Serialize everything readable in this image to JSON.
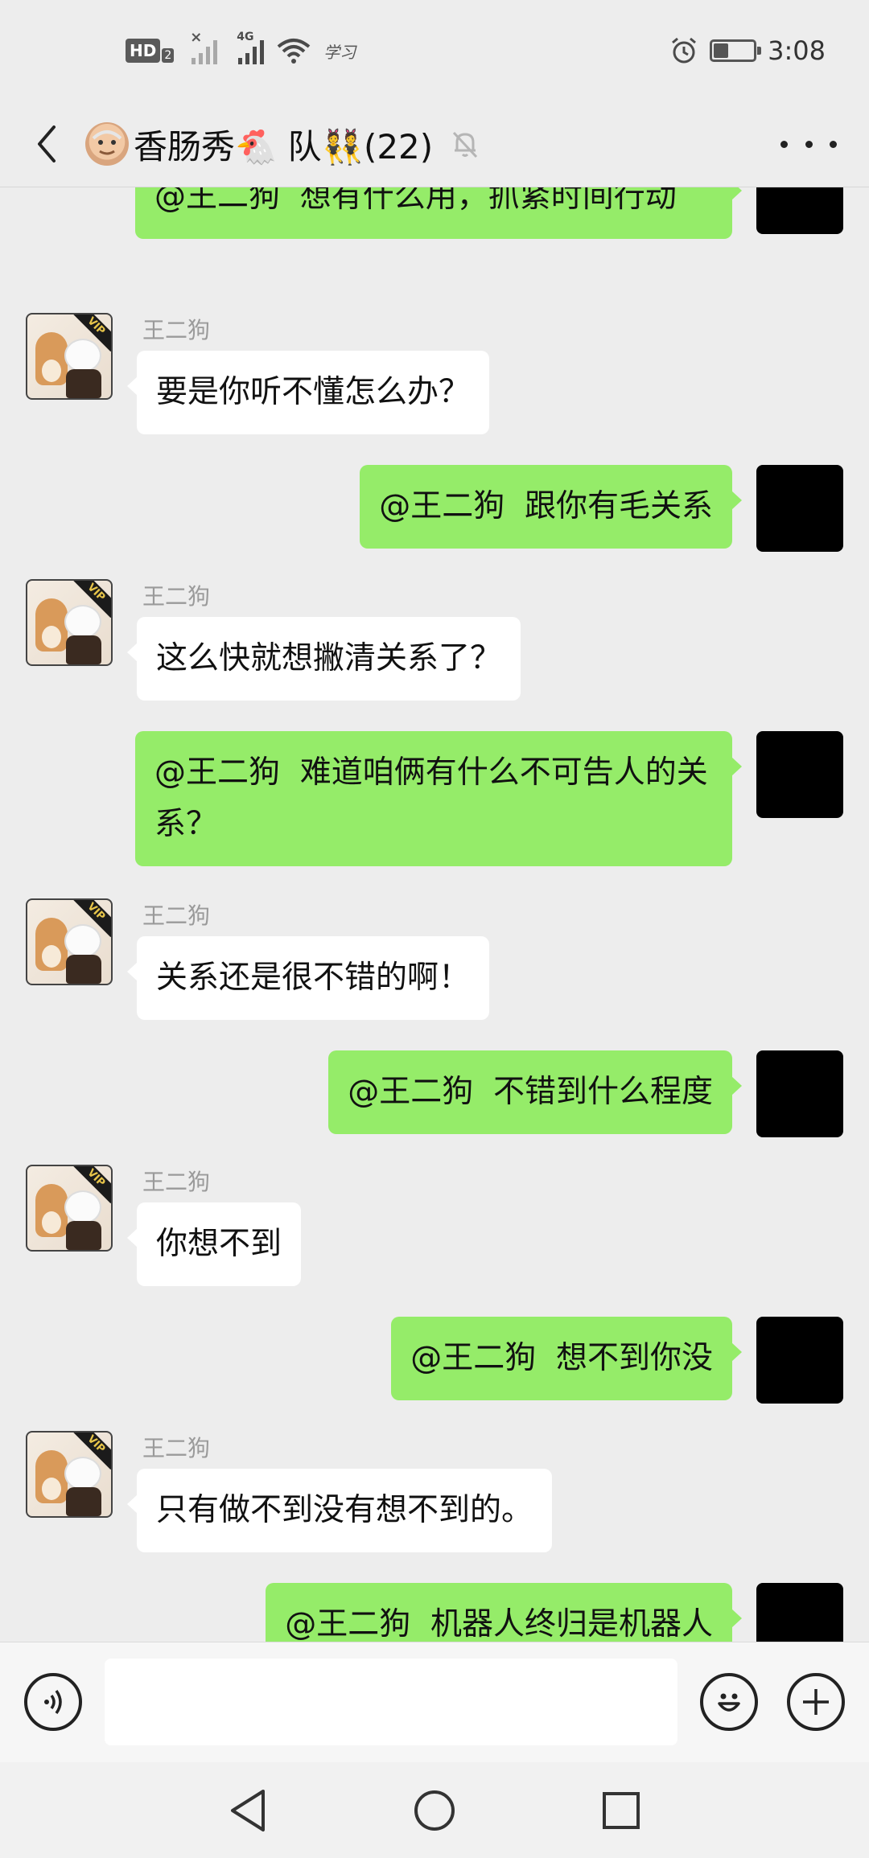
{
  "status_bar": {
    "hd_label": "HD",
    "hd_sub": "2",
    "network_type": "4G",
    "extra_text": "学习",
    "time": "3:08",
    "battery_level_fraction": 0.35
  },
  "header": {
    "title": "香肠秀🐔 队👯(22)",
    "back_icon": "chevron-left-icon",
    "mute_icon": "bell-off-icon",
    "more_icon": "more-dots-icon"
  },
  "messages": [
    {
      "sender": "self",
      "text": "@王二狗  想有什么用，抓紧时间行动"
    },
    {
      "sender": "other",
      "name": "王二狗",
      "text": "要是你听不懂怎么办？"
    },
    {
      "sender": "self",
      "text": "@王二狗  跟你有毛关系"
    },
    {
      "sender": "other",
      "name": "王二狗",
      "text": "这么快就想撇清关系了？"
    },
    {
      "sender": "self",
      "text": "@王二狗  难道咱俩有什么不可告人的关系？"
    },
    {
      "sender": "other",
      "name": "王二狗",
      "text": "关系还是很不错的啊！"
    },
    {
      "sender": "self",
      "text": "@王二狗  不错到什么程度"
    },
    {
      "sender": "other",
      "name": "王二狗",
      "text": "你想不到"
    },
    {
      "sender": "self",
      "text": "@王二狗  想不到你没"
    },
    {
      "sender": "other",
      "name": "王二狗",
      "text": "只有做不到没有想不到的。"
    },
    {
      "sender": "self",
      "text": "@王二狗  机器人终归是机器人"
    }
  ],
  "avatar_badge": "VIP",
  "input_bar": {
    "voice_icon": "voice-icon",
    "emoji_icon": "emoji-icon",
    "plus_icon": "plus-icon",
    "input_value": ""
  },
  "nav_bar": {
    "back_icon": "nav-back-icon",
    "home_icon": "nav-home-icon",
    "recents_icon": "nav-recents-icon"
  },
  "colors": {
    "self_bubble": "#95ec69",
    "other_bubble": "#ffffff",
    "background": "#ededed"
  }
}
